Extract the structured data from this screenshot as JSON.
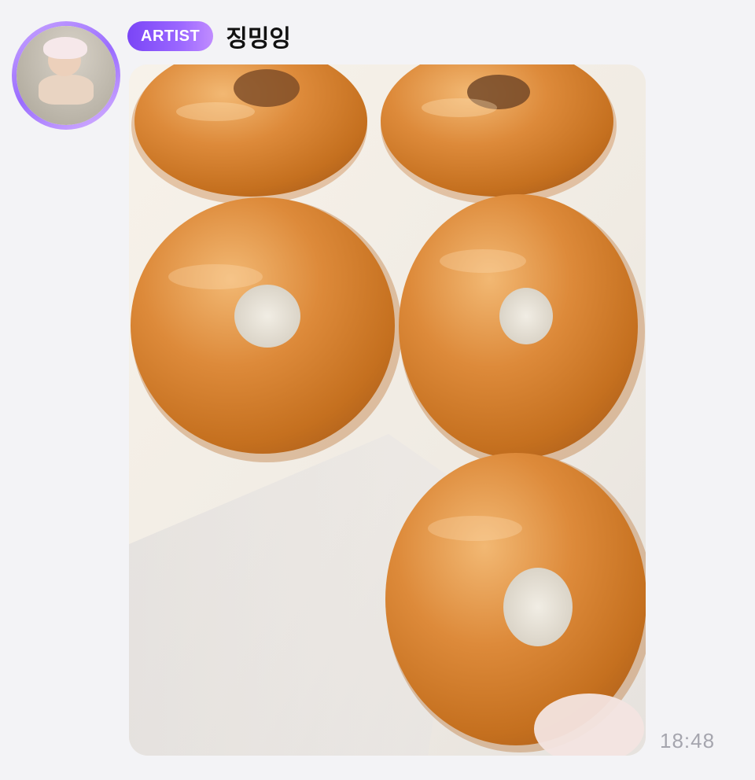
{
  "message": {
    "badge_label": "ARTIST",
    "sender_name": "징밍잉",
    "timestamp": "18:48",
    "attachment_icon": "photo-attachment"
  },
  "colors": {
    "badge_gradient_start": "#7a45f6",
    "badge_gradient_end": "#c08cff",
    "avatar_ring": "#9a6cff",
    "timestamp": "#a5a5ae",
    "background": "#f3f3f6"
  }
}
